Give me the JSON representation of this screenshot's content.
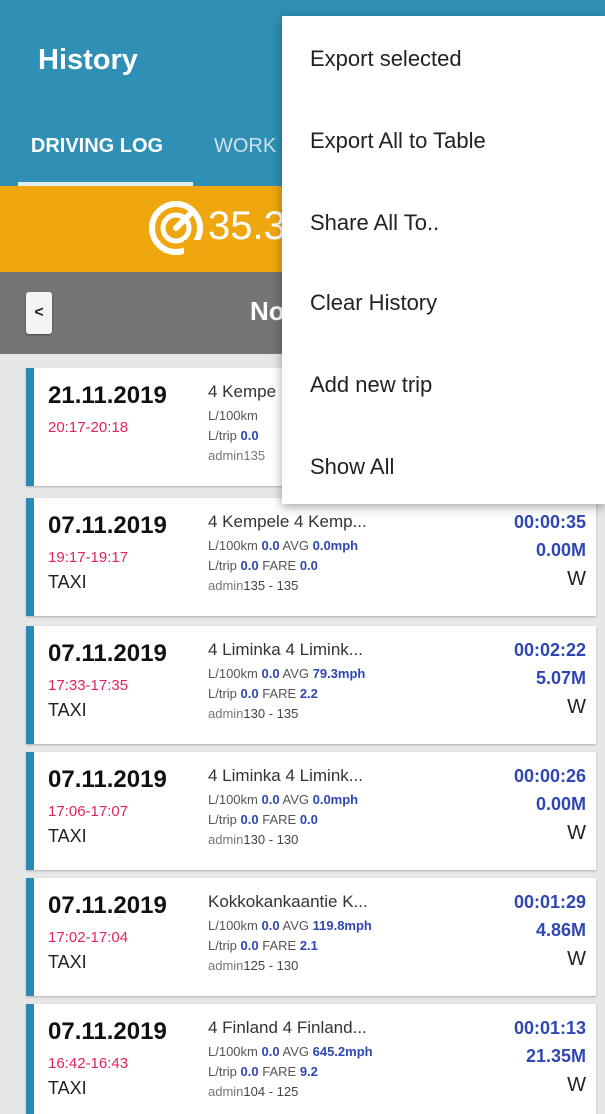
{
  "header": {
    "title": "History",
    "tabs": [
      {
        "label": "DRIVING LOG"
      },
      {
        "label": "WORK"
      }
    ]
  },
  "speed": {
    "value": "35.3",
    "icon": "speedometer-icon"
  },
  "date_nav": {
    "prev_label": "<",
    "current_label": "No"
  },
  "menu": {
    "items": [
      {
        "label": "Export selected"
      },
      {
        "label": "Export All to Table"
      },
      {
        "label": "Share All To.."
      },
      {
        "label": "Clear History"
      },
      {
        "label": "Add new trip"
      },
      {
        "label": "Show All"
      }
    ]
  },
  "trips": [
    {
      "date": "21.11.2019",
      "time": "20:17-20:18",
      "type": "",
      "route": "4 Kempe",
      "l100_label": "L/100km",
      "l100": "",
      "avg_label": "",
      "avg": "",
      "ltrip_label": "L/trip",
      "ltrip": "0.0",
      "fare_label": "",
      "fare": "",
      "user": "admin135",
      "odo": "",
      "duration": "",
      "distance": "",
      "dir": ""
    },
    {
      "date": "07.11.2019",
      "time": "19:17-19:17",
      "type": "TAXI",
      "route": "4 Kempele 4 Kemp...",
      "l100_label": "L/100km",
      "l100": "0.0",
      "avg_label": "AVG",
      "avg": "0.0mph",
      "ltrip_label": "L/trip",
      "ltrip": "0.0",
      "fare_label": "FARE",
      "fare": "0.0",
      "user": "admin",
      "odo": "135 - 135",
      "duration": "00:00:35",
      "distance": "0.00M",
      "dir": "W"
    },
    {
      "date": "07.11.2019",
      "time": "17:33-17:35",
      "type": "TAXI",
      "route": "4 Liminka 4 Limink...",
      "l100_label": "L/100km",
      "l100": "0.0",
      "avg_label": "AVG",
      "avg": "79.3mph",
      "ltrip_label": "L/trip",
      "ltrip": "0.0",
      "fare_label": "FARE",
      "fare": "2.2",
      "user": "admin",
      "odo": "130 - 135",
      "duration": "00:02:22",
      "distance": "5.07M",
      "dir": "W"
    },
    {
      "date": "07.11.2019",
      "time": "17:06-17:07",
      "type": "TAXI",
      "route": "4 Liminka 4 Limink...",
      "l100_label": "L/100km",
      "l100": "0.0",
      "avg_label": "AVG",
      "avg": "0.0mph",
      "ltrip_label": "L/trip",
      "ltrip": "0.0",
      "fare_label": "FARE",
      "fare": "0.0",
      "user": "admin",
      "odo": "130 - 130",
      "duration": "00:00:26",
      "distance": "0.00M",
      "dir": "W"
    },
    {
      "date": "07.11.2019",
      "time": "17:02-17:04",
      "type": "TAXI",
      "route": "Kokkokankaantie K...",
      "l100_label": "L/100km",
      "l100": "0.0",
      "avg_label": "AVG",
      "avg": "119.8mph",
      "ltrip_label": "L/trip",
      "ltrip": "0.0",
      "fare_label": "FARE",
      "fare": "2.1",
      "user": "admin",
      "odo": "125 - 130",
      "duration": "00:01:29",
      "distance": "4.86M",
      "dir": "W"
    },
    {
      "date": "07.11.2019",
      "time": "16:42-16:43",
      "type": "TAXI",
      "route": "4 Finland 4 Finland...",
      "l100_label": "L/100km",
      "l100": "0.0",
      "avg_label": "AVG",
      "avg": "645.2mph",
      "ltrip_label": "L/trip",
      "ltrip": "0.0",
      "fare_label": "FARE",
      "fare": "9.2",
      "user": "admin",
      "odo": "104 - 125",
      "duration": "00:01:13",
      "distance": "21.35M",
      "dir": "W"
    }
  ]
}
